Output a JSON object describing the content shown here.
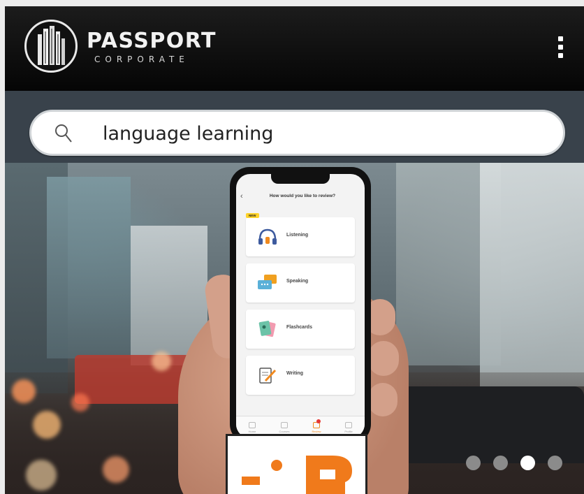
{
  "header": {
    "brand_title": "PASSPORT",
    "brand_subtitle": "CORPORATE",
    "menu_icon": "more-vertical-icon"
  },
  "search": {
    "value": "language learning",
    "icon": "search-icon"
  },
  "hero": {
    "phone_screen": {
      "header": "How would you like to review?",
      "back_icon": "chevron-left-icon",
      "new_badge": "NEW",
      "cards": [
        {
          "label": "Listening",
          "icon": "headphones-icon"
        },
        {
          "label": "Speaking",
          "icon": "speech-bubbles-icon"
        },
        {
          "label": "Flashcards",
          "icon": "flashcards-icon"
        },
        {
          "label": "Writing",
          "icon": "pencil-paper-icon"
        }
      ],
      "tabs": [
        {
          "label": "Home",
          "icon": "home-icon"
        },
        {
          "label": "Courses",
          "icon": "grid-icon"
        },
        {
          "label": "Review",
          "icon": "review-icon",
          "active": true
        },
        {
          "label": "Profile",
          "icon": "profile-icon"
        }
      ]
    },
    "logo_brand_color": "#f07a1b"
  },
  "carousel": {
    "total": 4,
    "active_index": 2
  },
  "colors": {
    "header_bg": "#0d0d0d",
    "band_bg": "#39424b",
    "accent": "#f07a1b"
  }
}
